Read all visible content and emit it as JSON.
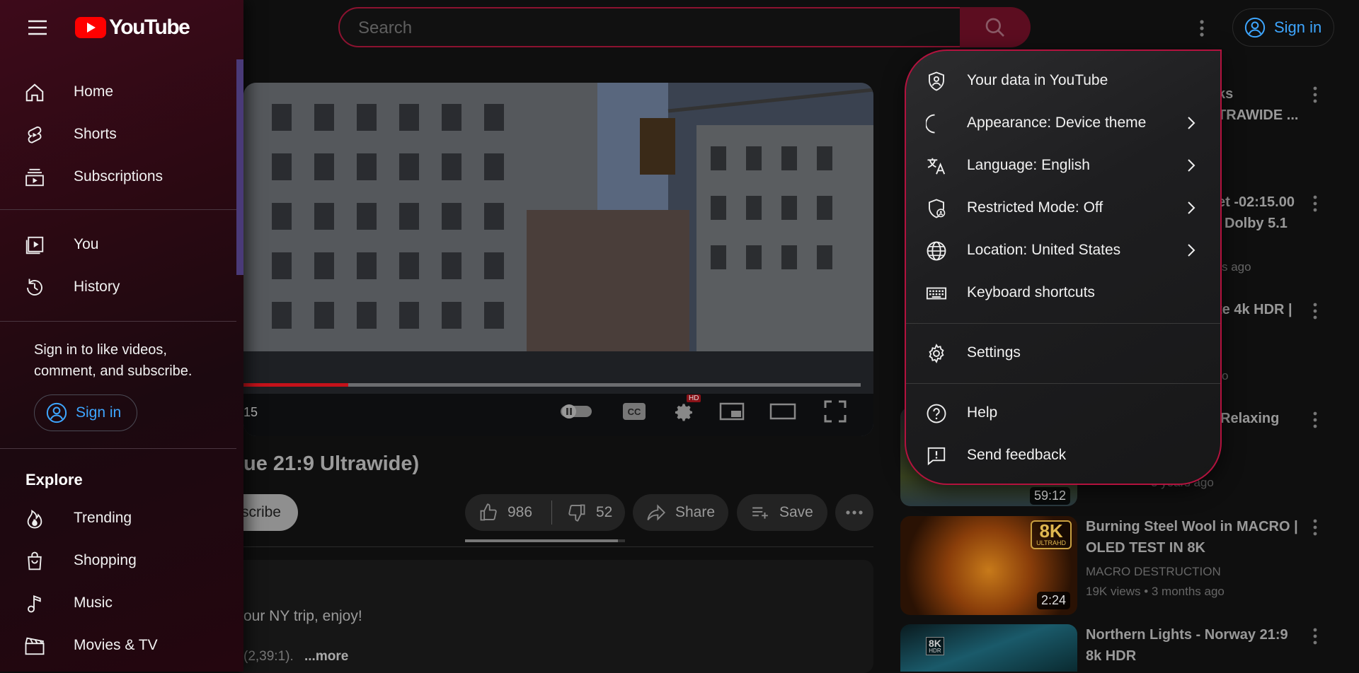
{
  "topbar": {
    "search_placeholder": "Search",
    "signin_label": "Sign in"
  },
  "brand": {
    "name": "YouTube"
  },
  "guide": {
    "main": [
      {
        "label": "Home",
        "icon": "home-icon"
      },
      {
        "label": "Shorts",
        "icon": "shorts-icon"
      },
      {
        "label": "Subscriptions",
        "icon": "subscriptions-icon"
      }
    ],
    "you": [
      {
        "label": "You",
        "icon": "you-icon"
      },
      {
        "label": "History",
        "icon": "history-icon"
      }
    ],
    "signin_prompt": "Sign in to like videos, comment, and subscribe.",
    "signin_label": "Sign in",
    "explore_title": "Explore",
    "explore": [
      {
        "label": "Trending",
        "icon": "trending-icon"
      },
      {
        "label": "Shopping",
        "icon": "shopping-icon"
      },
      {
        "label": "Music",
        "icon": "music-icon"
      },
      {
        "label": "Movies & TV",
        "icon": "movies-icon"
      }
    ]
  },
  "menu": {
    "items": [
      {
        "label": "Your data in YouTube",
        "icon": "shield-person-icon",
        "has_submenu": false
      },
      {
        "label": "Appearance: Device theme",
        "icon": "moon-icon",
        "has_submenu": true
      },
      {
        "label": "Language: English",
        "icon": "translate-icon",
        "has_submenu": true
      },
      {
        "label": "Restricted Mode: Off",
        "icon": "restricted-shield-icon",
        "has_submenu": true
      },
      {
        "label": "Location: United States",
        "icon": "globe-icon",
        "has_submenu": true
      },
      {
        "label": "Keyboard shortcuts",
        "icon": "keyboard-icon",
        "has_submenu": false
      },
      {
        "label": "Settings",
        "icon": "gear-icon",
        "has_submenu": false
      },
      {
        "label": "Help",
        "icon": "help-icon",
        "has_submenu": false
      },
      {
        "label": "Send feedback",
        "icon": "feedback-icon",
        "has_submenu": false
      }
    ]
  },
  "player": {
    "time_fragment": "15",
    "progress": 0.17,
    "hd_badge": "HD"
  },
  "video": {
    "title_fragment": "ue 21:9 Ultrawide)",
    "subscribe_fragment": "scribe",
    "likes": "986",
    "dislikes": "52",
    "share_label": "Share",
    "save_label": "Save",
    "description_fragment": "our NY trip, enjoy!",
    "description_fragment2": "(2,39:1).",
    "more_label": "...more"
  },
  "recommendations": [
    {
      "title_line1": "ks",
      "title_line2": "TRAWIDE ...",
      "meta": ""
    },
    {
      "title_line1": "et -02:15.00",
      "title_line2": "Dolby 5.1",
      "meta": "s ago"
    },
    {
      "title_line1": "te 4k HDR |",
      "title_line2": "",
      "meta": "o"
    },
    {
      "title_line1": "Relaxing",
      "title_line2": "",
      "meta": "3 years ago",
      "duration": "59:12"
    },
    {
      "title_line1": "Burning Steel Wool in MACRO |",
      "title_line2": "OLED TEST IN 8K",
      "channel": "MACRO DESTRUCTION",
      "meta": "19K views  • 3 months ago",
      "duration": "2:24",
      "badge_top": "8K",
      "badge_bottom": "ULTRAHD"
    },
    {
      "title_line1": "Northern Lights - Norway 21:9",
      "title_line2": "8k HDR",
      "badge_top": "8K",
      "badge_bottom": "HDR"
    }
  ],
  "colors": {
    "accent_link": "#3ea6ff",
    "menu_border": "#b3123e",
    "progress_red": "#c4121a",
    "guide_bg": "#2a0912"
  }
}
